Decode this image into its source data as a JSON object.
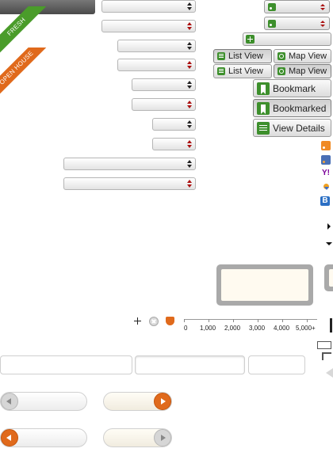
{
  "ribbons": {
    "fresh": "FRESH",
    "open_house": "OPEN HOUSE"
  },
  "buttons": {
    "list_view": "List View",
    "map_view": "Map View",
    "bookmark": "Bookmark",
    "bookmarked": "Bookmarked",
    "view_details": "View Details"
  },
  "side_icons": [
    "rss-icon",
    "rss-blue-icon",
    "yahoo-icon",
    "download-icon",
    "blogger-icon"
  ],
  "scale": {
    "labels": [
      "0",
      "1,000",
      "2,000",
      "3,000",
      "4,000",
      "5,000+"
    ]
  },
  "colors": {
    "accent_green": "#3d8f2c",
    "accent_orange": "#e06a1c",
    "ribbon_green": "#4a9c2a"
  }
}
